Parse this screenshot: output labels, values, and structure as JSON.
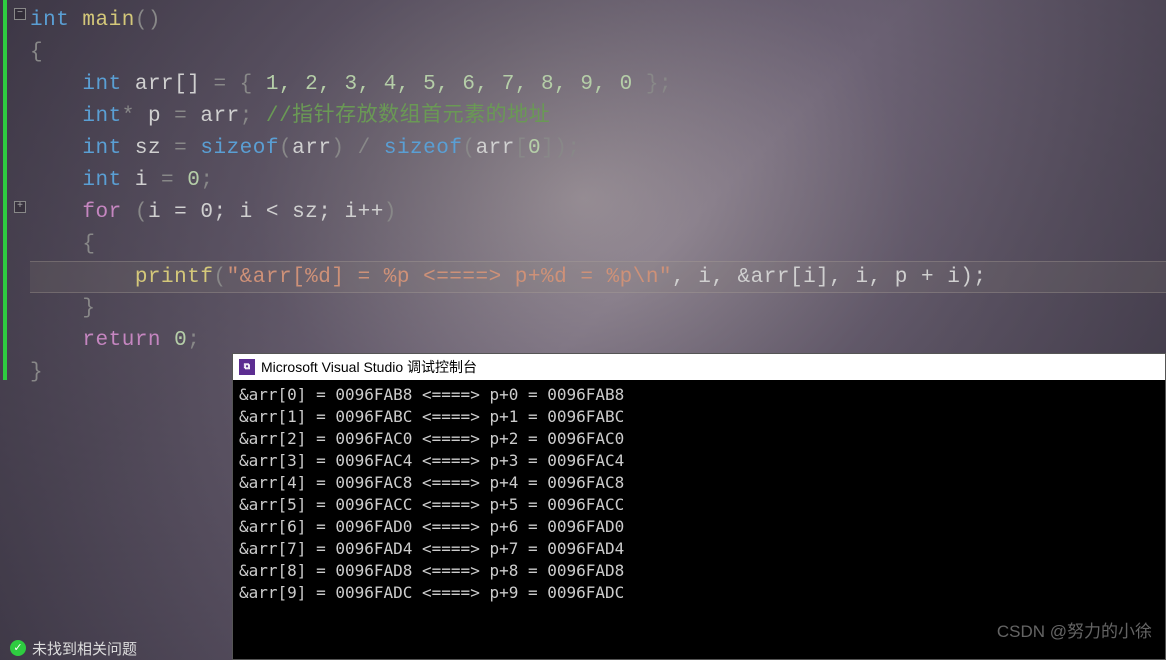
{
  "code": {
    "line0": {
      "kw": "int",
      "fn": " main",
      "paren": "()"
    },
    "line1": "{",
    "line2": {
      "kw": "int",
      "id": " arr[] ",
      "op": "= { ",
      "nums": "1, 2, 3, 4, 5, 6, 7, 8, 9, 0",
      "end": " };"
    },
    "line3": {
      "kw": "int",
      "star": "*",
      "id": " p ",
      "eq": "= ",
      "arr": "arr",
      "sc": ";",
      "comment": " //指针存放数组首元素的地址"
    },
    "line4": {
      "kw": "int",
      "id": " sz ",
      "eq": "= ",
      "szof1": "sizeof",
      "p1": "(",
      "a1": "arr",
      "p2": ") / ",
      "szof2": "sizeof",
      "p3": "(",
      "a2": "arr",
      "br": "[",
      "z": "0",
      "br2": "]",
      "p4": ");"
    },
    "line5": {
      "kw": "int",
      "id": " i ",
      "eq": "= ",
      "z": "0",
      "sc": ";"
    },
    "line6": {
      "kw": "for",
      "open": " (",
      "body": "i = 0; i < sz; i++",
      "close": ")"
    },
    "line7": "{",
    "line8": {
      "fn": "printf",
      "p1": "(",
      "str": "\"&arr[%d] = %p <====> p+%d = %p\\n\"",
      "args": ", i, &arr[i], i, p + i);"
    },
    "line9": "}",
    "line10": {
      "kw": "return",
      "sp": " ",
      "z": "0",
      "sc": ";"
    },
    "line11": "}"
  },
  "console": {
    "title": "Microsoft Visual Studio 调试控制台",
    "lines": [
      "&arr[0] = 0096FAB8 <====> p+0 = 0096FAB8",
      "&arr[1] = 0096FABC <====> p+1 = 0096FABC",
      "&arr[2] = 0096FAC0 <====> p+2 = 0096FAC0",
      "&arr[3] = 0096FAC4 <====> p+3 = 0096FAC4",
      "&arr[4] = 0096FAC8 <====> p+4 = 0096FAC8",
      "&arr[5] = 0096FACC <====> p+5 = 0096FACC",
      "&arr[6] = 0096FAD0 <====> p+6 = 0096FAD0",
      "&arr[7] = 0096FAD4 <====> p+7 = 0096FAD4",
      "&arr[8] = 0096FAD8 <====> p+8 = 0096FAD8",
      "&arr[9] = 0096FADC <====> p+9 = 0096FADC"
    ]
  },
  "status": {
    "text": "未找到相关问题"
  },
  "watermark": "CSDN @努力的小徐"
}
